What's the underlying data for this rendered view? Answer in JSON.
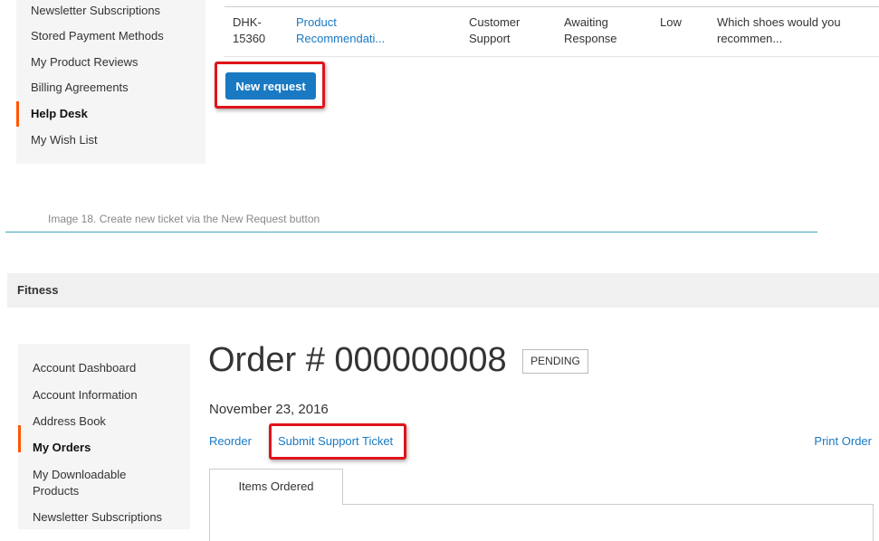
{
  "top_sidebar": {
    "items": [
      {
        "label": "Newsletter Subscriptions",
        "active": false
      },
      {
        "label": "Stored Payment Methods",
        "active": false
      },
      {
        "label": "My Product Reviews",
        "active": false
      },
      {
        "label": "Billing Agreements",
        "active": false
      },
      {
        "label": "Help Desk",
        "active": true
      },
      {
        "label": "My Wish List",
        "active": false
      }
    ]
  },
  "tickets": {
    "rows": [
      {
        "id_line1": "DHK-",
        "id_line2": "15360",
        "subject_line1": "Product",
        "subject_line2": "Recommendati...",
        "department_line1": "Customer",
        "department_line2": "Support",
        "status_line1": "Awaiting",
        "status_line2": "Response",
        "priority": "Low",
        "message_line1": "Which shoes would you",
        "message_line2": "recommen..."
      }
    ]
  },
  "new_request_label": "New request",
  "caption": "Image 18. Create new ticket via the New Request button",
  "store_bar": {
    "title": "Fitness"
  },
  "bottom_sidebar": {
    "items": [
      {
        "label": "Account Dashboard"
      },
      {
        "label": "Account Information"
      },
      {
        "label": "Address Book"
      },
      {
        "label": "My Orders"
      },
      {
        "label_line1": "My Downloadable",
        "label_line2": "Products"
      },
      {
        "label": "Newsletter Subscriptions"
      }
    ]
  },
  "order": {
    "title": "Order # 000000008",
    "status": "PENDING",
    "date": "November 23, 2016",
    "actions": {
      "reorder": "Reorder",
      "submit_ticket": "Submit Support Ticket",
      "print": "Print Order"
    },
    "tabs": [
      {
        "label": "Items Ordered"
      }
    ]
  },
  "colors": {
    "accent": "#1979c3",
    "active_marker": "#ff5501",
    "highlight": "#e0141b",
    "caption_rule": "#3ba6b5"
  }
}
